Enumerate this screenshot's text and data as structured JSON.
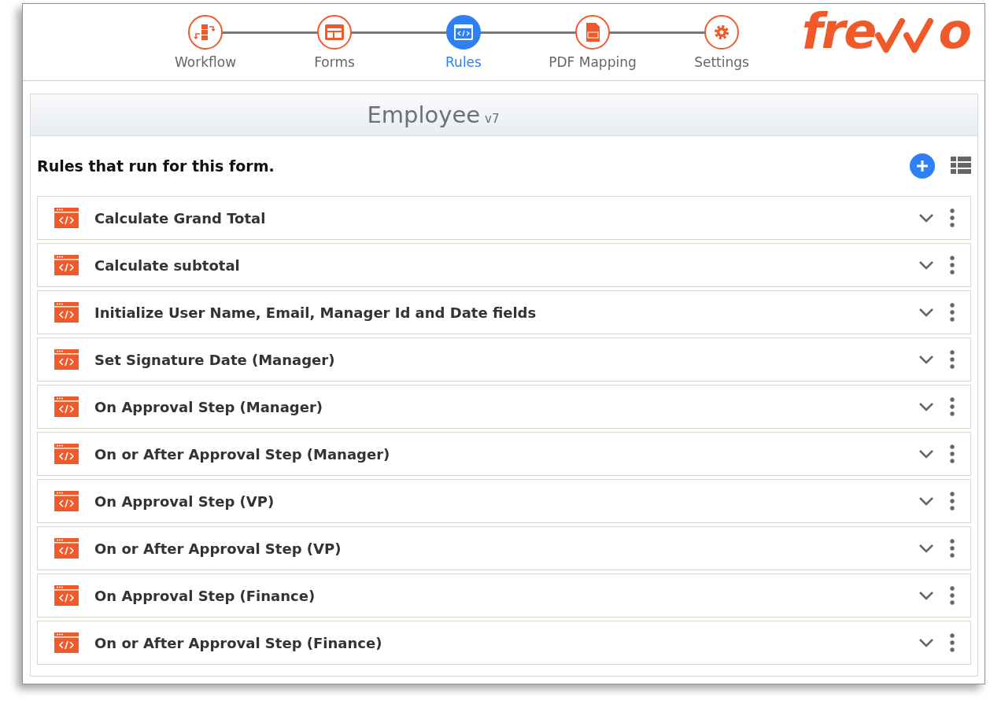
{
  "steps": [
    {
      "label": "Workflow",
      "kind": "workflow",
      "selected": false
    },
    {
      "label": "Forms",
      "kind": "forms",
      "selected": false
    },
    {
      "label": "Rules",
      "kind": "rules",
      "selected": true
    },
    {
      "label": "PDF Mapping",
      "kind": "pdf",
      "selected": false
    },
    {
      "label": "Settings",
      "kind": "settings",
      "selected": false
    }
  ],
  "logo": {
    "text_start": "fre",
    "text_end": "o"
  },
  "form": {
    "title": "Employee",
    "version": "v7"
  },
  "heading": "Rules that run for this form.",
  "rules": [
    {
      "name": "Calculate Grand Total",
      "expanded": false
    },
    {
      "name": "Calculate subtotal",
      "expanded": false
    },
    {
      "name": "Initialize User Name, Email, Manager Id and Date fields",
      "expanded": false
    },
    {
      "name": "Set Signature Date (Manager)",
      "expanded": false
    },
    {
      "name": "On Approval Step (Manager)",
      "expanded": false
    },
    {
      "name": "On or After Approval Step (Manager)",
      "expanded": false
    },
    {
      "name": "On Approval Step (VP)",
      "expanded": false
    },
    {
      "name": "On or After Approval Step (VP)",
      "expanded": false
    },
    {
      "name": "On Approval Step (Finance)",
      "expanded": false
    },
    {
      "name": "On or After Approval Step (Finance)",
      "expanded": false
    }
  ]
}
